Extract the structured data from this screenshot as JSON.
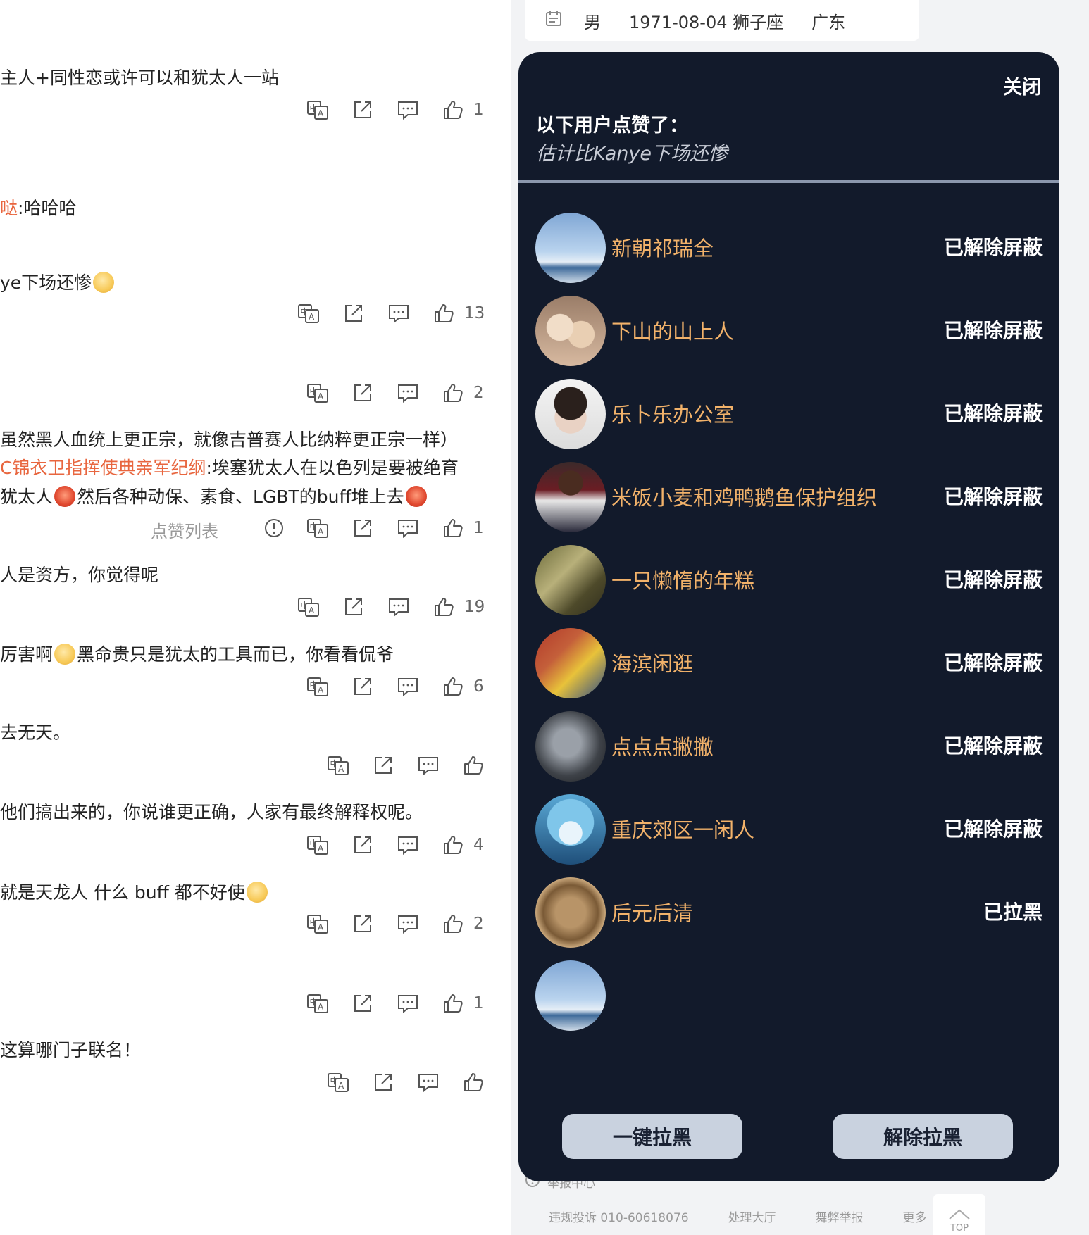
{
  "profile": {
    "gender": "男",
    "birthday": "1971-08-04 狮子座",
    "region": "广东"
  },
  "comments": [
    {
      "parts": [
        {
          "t": "主人+同性恋或许可以和犹太人一站"
        }
      ],
      "likes": "1"
    },
    {
      "parts": [
        {
          "t": "哒",
          "hl": true
        },
        {
          "t": ":哈哈哈"
        }
      ]
    },
    {
      "parts": [
        {
          "t": "ye下场还惨"
        },
        {
          "e": "doge"
        }
      ],
      "likes": "13"
    },
    {
      "likes": "2"
    },
    {
      "parts": [
        {
          "t": "虽然黑人血统上更正宗，就像吉普赛人比纳粹更正宗一样）"
        }
      ]
    },
    {
      "parts": [
        {
          "t": "C锦衣卫指挥使典亲军纪纲",
          "hl": true
        },
        {
          "t": ":埃塞犹太人在以色列是要被绝育"
        }
      ]
    },
    {
      "parts": [
        {
          "t": "犹太人"
        },
        {
          "e": "red"
        },
        {
          "t": "然后各种动保、素食、LGBT的buff堆上去"
        },
        {
          "e": "red"
        }
      ],
      "likes": "1",
      "likelist": "点赞列表"
    },
    {
      "parts": [
        {
          "t": "人是资方，你觉得呢"
        }
      ],
      "likes": "19"
    },
    {
      "parts": [
        {
          "t": "厉害啊"
        },
        {
          "e": "doge"
        },
        {
          "t": "黑命贵只是犹太的工具而已，你看看侃爷"
        }
      ],
      "likes": "6"
    },
    {
      "parts": [
        {
          "t": "去无天。"
        }
      ]
    },
    {
      "parts": [
        {
          "t": "他们搞出来的，你说谁更正确，人家有最终解释权呢。"
        }
      ],
      "likes": "4"
    },
    {
      "parts": [
        {
          "t": "就是天龙人    什么 buff 都不好使"
        },
        {
          "e": "doge"
        }
      ],
      "likes": "2"
    },
    {
      "likes": "1"
    },
    {
      "parts": [
        {
          "t": "这算哪门子联名！"
        }
      ]
    }
  ],
  "modal": {
    "close_label": "关闭",
    "title": "以下用户点赞了：",
    "subtitle": "估计比Kanye下场还惨",
    "users": [
      {
        "name": "新朝祁瑞全",
        "status": "已解除屏蔽",
        "avatar": "sky"
      },
      {
        "name": "下山的山上人",
        "status": "已解除屏蔽",
        "avatar": "cats"
      },
      {
        "name": "乐卜乐办公室",
        "status": "已解除屏蔽",
        "avatar": "portrait"
      },
      {
        "name": "米饭小麦和鸡鸭鹅鱼保护组织",
        "status": "已解除屏蔽",
        "avatar": "athlete"
      },
      {
        "name": "一只懒惰的年糕",
        "status": "已解除屏蔽",
        "avatar": "forest"
      },
      {
        "name": "海滨闲逛",
        "status": "已解除屏蔽",
        "avatar": "face"
      },
      {
        "name": "点点点撇撇",
        "status": "已解除屏蔽",
        "avatar": "metal"
      },
      {
        "name": "重庆郊区一闲人",
        "status": "已解除屏蔽",
        "avatar": "toy"
      },
      {
        "name": "后元后清",
        "status": "已拉黑",
        "avatar": "coin"
      },
      {
        "name": "",
        "status": "",
        "avatar": "sky"
      }
    ],
    "block_all_label": "一键拉黑",
    "unblock_label": "解除拉黑"
  },
  "footer": {
    "report_center": "举报中心",
    "links": [
      "违规投诉 010-60618076",
      "处理大厅",
      "舞弊举报",
      "更多"
    ],
    "top_label": "TOP"
  },
  "colors": {
    "modal_bg": "#121a2b",
    "username": "#f2b26a",
    "highlight": "#e8663f",
    "modal_button": "#c9d2df"
  }
}
